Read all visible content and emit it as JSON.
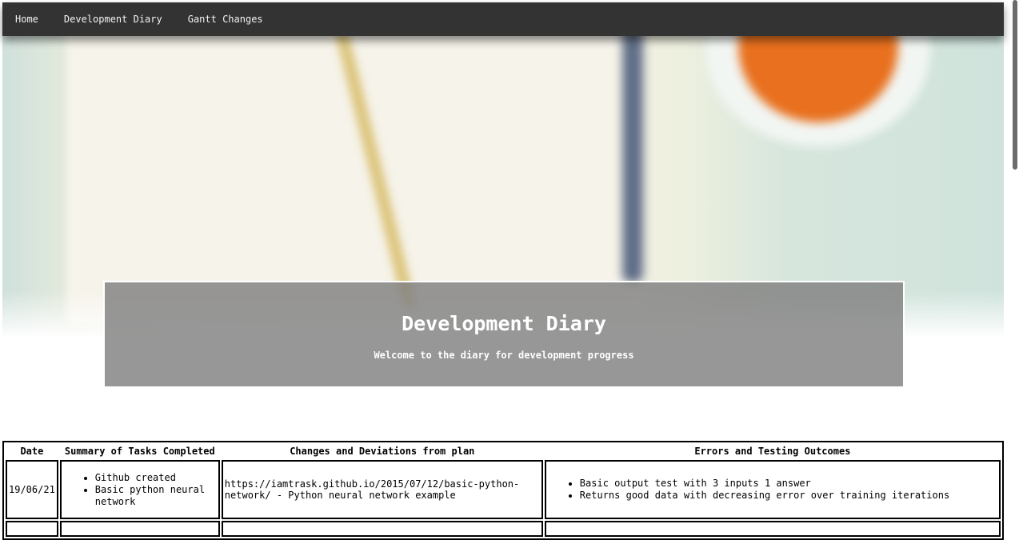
{
  "nav": {
    "home": "Home",
    "diary": "Development Diary",
    "gantt": "Gantt Changes"
  },
  "header": {
    "title": "Development Diary",
    "subtitle": "Welcome to the diary for development progress"
  },
  "table": {
    "headers": {
      "date": "Date",
      "summary": "Summary of Tasks Completed",
      "changes": "Changes and Deviations from plan",
      "errors": "Errors and Testing Outcomes"
    },
    "rows": [
      {
        "date": "19/06/21",
        "summary": [
          "Github created",
          "Basic python neural network"
        ],
        "changes": "https://iamtrask.github.io/2015/07/12/basic-python-network/ - Python neural network example",
        "errors": [
          "Basic output test with 3 inputs 1 answer",
          "Returns good data with decreasing error over training iterations"
        ]
      }
    ]
  },
  "colors": {
    "nav_bg": "#333333",
    "header_overlay": "#808080"
  }
}
